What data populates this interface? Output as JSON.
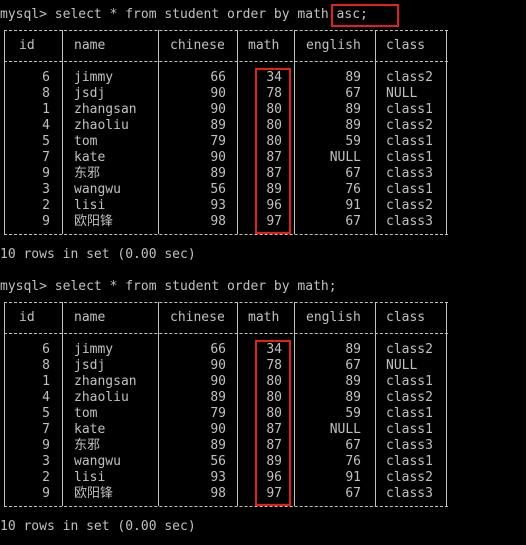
{
  "colors": {
    "background": "#000000",
    "text": "#c0c0c0",
    "highlight": "#e02020"
  },
  "block1": {
    "prompt": "mysql> select * from student order by math asc;",
    "result_summary": "10 rows in set (0.00 sec)"
  },
  "block2": {
    "prompt": "mysql> select * from student order by math;",
    "result_summary": "10 rows in set (0.00 sec)"
  },
  "table": {
    "headers": [
      "id",
      "name",
      "chinese",
      "math",
      "english",
      "class"
    ],
    "rows": [
      [
        "6",
        "jimmy",
        "66",
        "34",
        "89",
        "class2"
      ],
      [
        "8",
        "jsdj",
        "90",
        "78",
        "67",
        "NULL"
      ],
      [
        "1",
        "zhangsan",
        "90",
        "80",
        "89",
        "class1"
      ],
      [
        "4",
        "zhaoliu",
        "89",
        "80",
        "89",
        "class2"
      ],
      [
        "5",
        "tom",
        "79",
        "80",
        "59",
        "class1"
      ],
      [
        "7",
        "kate",
        "90",
        "87",
        "NULL",
        "class1"
      ],
      [
        "9",
        "东邪",
        "89",
        "87",
        "67",
        "class3"
      ],
      [
        "3",
        "wangwu",
        "56",
        "89",
        "76",
        "class1"
      ],
      [
        "2",
        "lisi",
        "93",
        "96",
        "91",
        "class2"
      ],
      [
        "9",
        "欧阳锋",
        "98",
        "97",
        "67",
        "class3"
      ]
    ]
  }
}
